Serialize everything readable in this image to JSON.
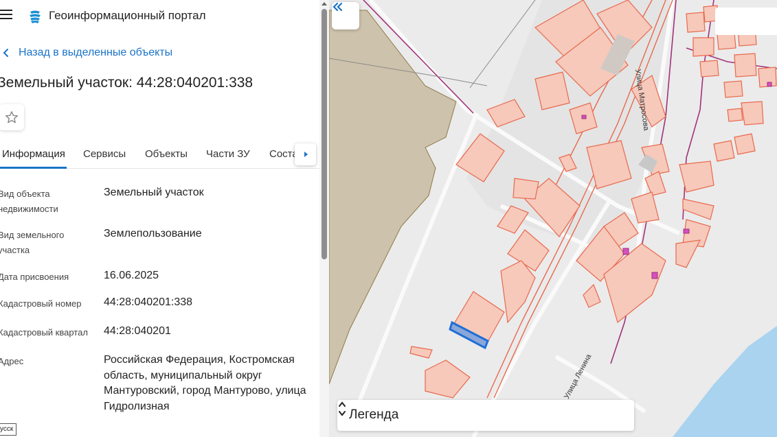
{
  "app": {
    "title": "Геоинформационный портал"
  },
  "nav": {
    "back_label": "Назад в выделенные объекты"
  },
  "page": {
    "title": "Земельный участок: 44:28:040201:338"
  },
  "tabs": [
    {
      "label": "Информация",
      "active": true
    },
    {
      "label": "Сервисы"
    },
    {
      "label": "Объекты"
    },
    {
      "label": "Части ЗУ"
    },
    {
      "label": "Соста"
    }
  ],
  "properties": [
    {
      "label": "Вид объекта недвижимости",
      "value": "Земельный участок"
    },
    {
      "label": "Вид земельного участка",
      "value": "Землепользование"
    },
    {
      "label": "Дата присвоения",
      "value": "16.06.2025"
    },
    {
      "label": "Кадастровый номер",
      "value": "44:28:040201:338"
    },
    {
      "label": "Кадастровый квартал",
      "value": "44:28:040201"
    },
    {
      "label": "Адрес",
      "value": "Российская Федерация, Костромская область, муниципальный округ Мантуровский, город Мантурово, улица Гидролизная"
    }
  ],
  "lang_tag": "усск",
  "map": {
    "streets": {
      "matrosova": "Улица Матросова",
      "lenina": "Улица Ленина"
    },
    "legend_title": "Легенда",
    "colors": {
      "parcel_fill": "#f6c9bb",
      "parcel_stroke": "#e9684c",
      "selected": "#1f6fd6",
      "boundary": "#a0317a",
      "field": "#cdc2ab",
      "water": "#a9d3ee"
    }
  },
  "icons": [
    "menu-icon",
    "portal-logo-icon",
    "chevron-left-icon",
    "star-icon",
    "caret-right-icon",
    "double-chevron-left-icon",
    "sort-arrows-icon"
  ]
}
